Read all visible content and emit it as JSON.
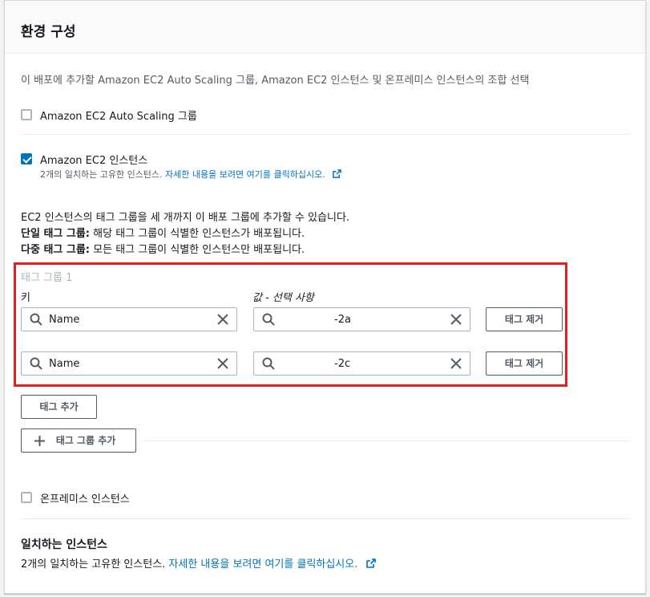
{
  "section": {
    "title": "환경 구성",
    "description": "이 배포에 추가할 Amazon EC2 Auto Scaling 그룹, Amazon EC2 인스턴스 및 온프레미스 인스턴스의 조합 선택"
  },
  "options": {
    "asg": {
      "label": "Amazon EC2 Auto Scaling 그룹",
      "checked": false
    },
    "ec2": {
      "label": "Amazon EC2 인스턴스",
      "checked": true,
      "match_text": "2개의 일치하는 고유한 인스턴스.",
      "match_link": "자세한 내용을 보려면 여기를 클릭하십시오."
    },
    "onprem": {
      "label": "온프레미스 인스턴스",
      "checked": false
    }
  },
  "tag_info": {
    "line1": "EC2 인스턴스의 태그 그룹을 세 개까지 이 배포 그룹에 추가할 수 있습니다.",
    "single_bold": "단일 태그 그룹:",
    "single_text": " 해당 태그 그룹이 식별한 인스턴스가 배포됩니다.",
    "multi_bold": "다중 태그 그룹:",
    "multi_text": " 모든 태그 그룹이 식별한 인스턴스만 배포됩니다."
  },
  "tag_group": {
    "label": "태그 그룹 1",
    "key_label": "키",
    "value_label": "값 - 선택 사항",
    "rows": [
      {
        "key": "Name",
        "value": "-2a",
        "remove_label": "태그 제거"
      },
      {
        "key": "Name",
        "value": "-2c",
        "remove_label": "태그 제거"
      }
    ]
  },
  "buttons": {
    "add_tag": "태그 추가",
    "add_tag_group": "태그 그룹 추가"
  },
  "matching": {
    "title": "일치하는 인스턴스",
    "text": "2개의 일치하는 고유한 인스턴스.",
    "link": "자세한 내용을 보려면 여기를 클릭하십시오."
  },
  "colors": {
    "link": "#0073bb",
    "checkbox_checked": "#0073bb",
    "highlight_box": "#e22020"
  }
}
